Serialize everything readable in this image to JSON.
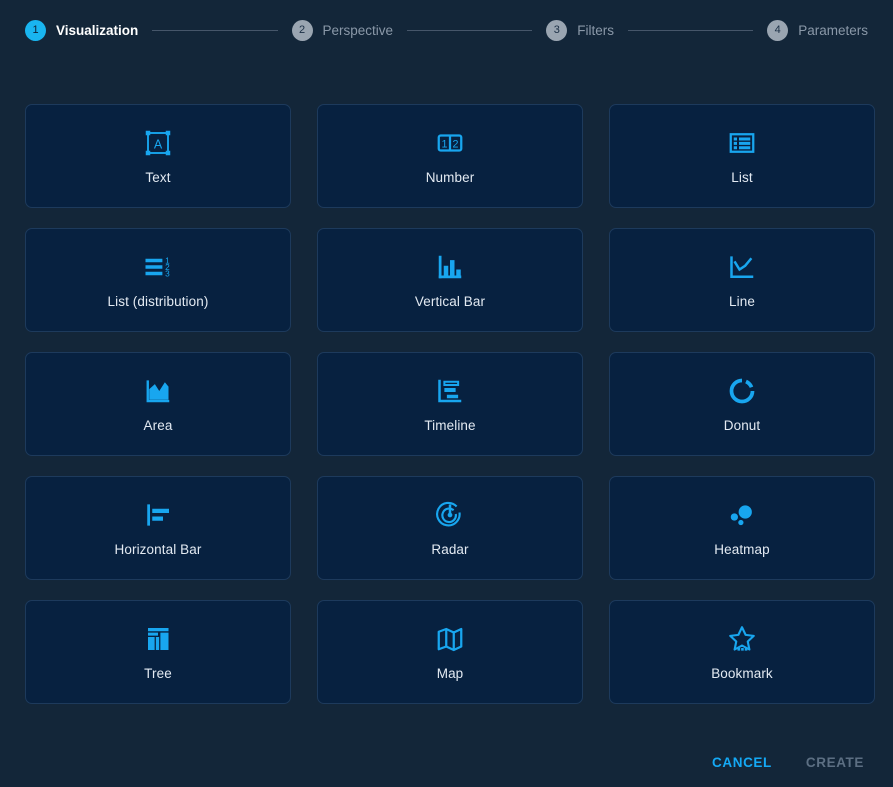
{
  "stepper": {
    "steps": [
      {
        "number": "1",
        "label": "Visualization",
        "active": true
      },
      {
        "number": "2",
        "label": "Perspective",
        "active": false
      },
      {
        "number": "3",
        "label": "Filters",
        "active": false
      },
      {
        "number": "4",
        "label": "Parameters",
        "active": false
      }
    ]
  },
  "colors": {
    "page_background": "#132639",
    "card_background": "#072140",
    "card_border": "#1d3a5c",
    "accent": "#18a6ef",
    "active_step": "#19b5f0",
    "inactive_step": "#9aa5b1",
    "label_text": "#e3eaf2",
    "muted_text": "#8a98a8",
    "disabled_text": "#5c6f83"
  },
  "visualizations": [
    {
      "label": "Text",
      "icon": "text-selection-icon"
    },
    {
      "label": "Number",
      "icon": "number-counter-icon"
    },
    {
      "label": "List",
      "icon": "list-icon"
    },
    {
      "label": "List (distribution)",
      "icon": "list-distribution-icon"
    },
    {
      "label": "Vertical Bar",
      "icon": "vertical-bar-chart-icon"
    },
    {
      "label": "Line",
      "icon": "line-chart-icon"
    },
    {
      "label": "Area",
      "icon": "area-chart-icon"
    },
    {
      "label": "Timeline",
      "icon": "timeline-icon"
    },
    {
      "label": "Donut",
      "icon": "donut-chart-icon"
    },
    {
      "label": "Horizontal Bar",
      "icon": "horizontal-bar-chart-icon"
    },
    {
      "label": "Radar",
      "icon": "radar-icon"
    },
    {
      "label": "Heatmap",
      "icon": "heatmap-bubbles-icon"
    },
    {
      "label": "Tree",
      "icon": "treemap-icon"
    },
    {
      "label": "Map",
      "icon": "map-icon"
    },
    {
      "label": "Bookmark",
      "icon": "star-bookmark-icon"
    }
  ],
  "footer": {
    "cancel_label": "CANCEL",
    "create_label": "CREATE"
  }
}
